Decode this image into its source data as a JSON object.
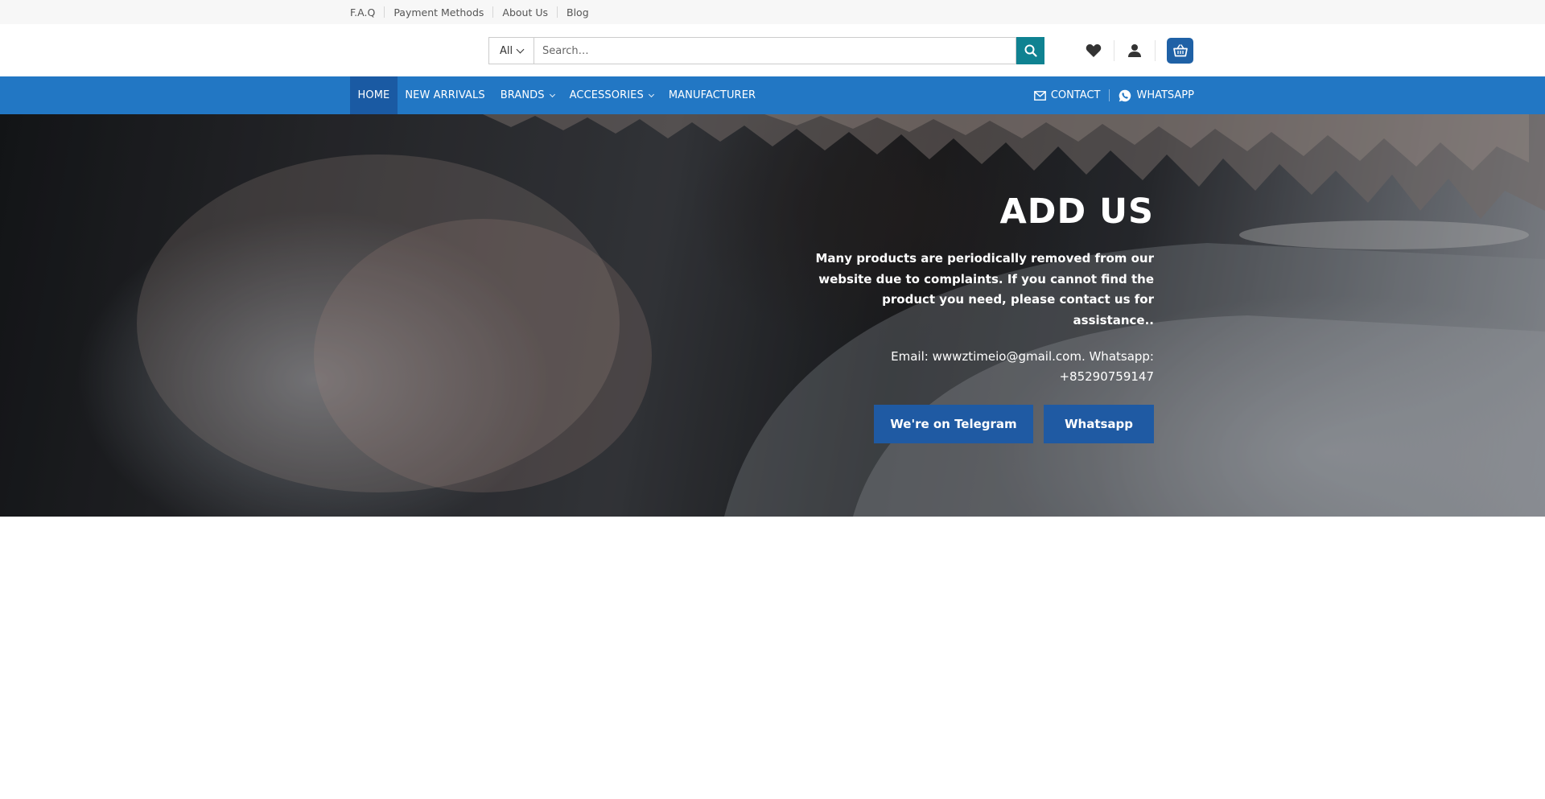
{
  "topbar": {
    "links": [
      "F.A.Q",
      "Payment Methods",
      "About Us",
      "Blog"
    ]
  },
  "header": {
    "search": {
      "category": "All",
      "placeholder": "Search…"
    },
    "icons": [
      "heart-icon",
      "user-icon",
      "basket-icon"
    ]
  },
  "nav": {
    "items": [
      {
        "label": "HOME",
        "active": true
      },
      {
        "label": "NEW ARRIVALS"
      },
      {
        "label": "BRANDS",
        "dropdown": true
      },
      {
        "label": "ACCESSORIES",
        "dropdown": true
      },
      {
        "label": "MANUFACTURER"
      }
    ],
    "right": {
      "contact": "CONTACT",
      "whatsapp": "WHATSAPP"
    }
  },
  "hero": {
    "title": "ADD US",
    "description": "Many products are periodically removed from our website due to complaints. If you cannot find the product you need, please contact us for assistance..",
    "contact": "Email: wwwztimeio@gmail.com. Whatsapp: +85290759147",
    "buttons": {
      "telegram": "We're on Telegram",
      "whatsapp": "Whatsapp"
    }
  },
  "colors": {
    "nav": "#2277c4",
    "nav_active": "#1a5aa3",
    "search_button": "#0f8291",
    "button": "#1f5aa3"
  }
}
